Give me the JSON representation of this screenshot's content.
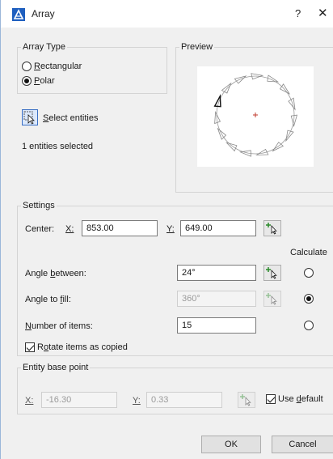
{
  "window": {
    "title": "Array",
    "help_label": "?",
    "close_label": "✕",
    "icon": "array-app-icon",
    "accent_color": "#1f5fbf"
  },
  "array_type": {
    "legend": "Array Type",
    "options": [
      {
        "label": "Rectangular",
        "selected": false
      },
      {
        "label": "Polar",
        "selected": true
      }
    ]
  },
  "preview": {
    "legend": "Preview",
    "item_count": 15,
    "center_marker_color": "#c0392b"
  },
  "selection": {
    "button_label": "Select entities",
    "status": "1 entities selected"
  },
  "settings": {
    "legend": "Settings",
    "center_label": "Center:",
    "x_label": "X:",
    "x_value": "853.00",
    "y_label": "Y:",
    "y_value": "649.00",
    "calculate_header": "Calculate",
    "angle_between_label": "Angle between:",
    "angle_between_value": "24°",
    "angle_to_fill_label": "Angle to fill:",
    "angle_to_fill_value": "360°",
    "number_of_items_label": "Number of items:",
    "number_of_items_value": "15",
    "calculate_selected": "angle_to_fill",
    "rotate_label": "Rotate items as copied",
    "rotate_checked": true
  },
  "entity_base_point": {
    "legend": "Entity base point",
    "x_label": "X:",
    "x_value": "-16.30",
    "y_label": "Y:",
    "y_value": "0.33",
    "use_default_label": "Use default",
    "use_default_checked": true
  },
  "footer": {
    "ok_label": "OK",
    "cancel_label": "Cancel"
  }
}
